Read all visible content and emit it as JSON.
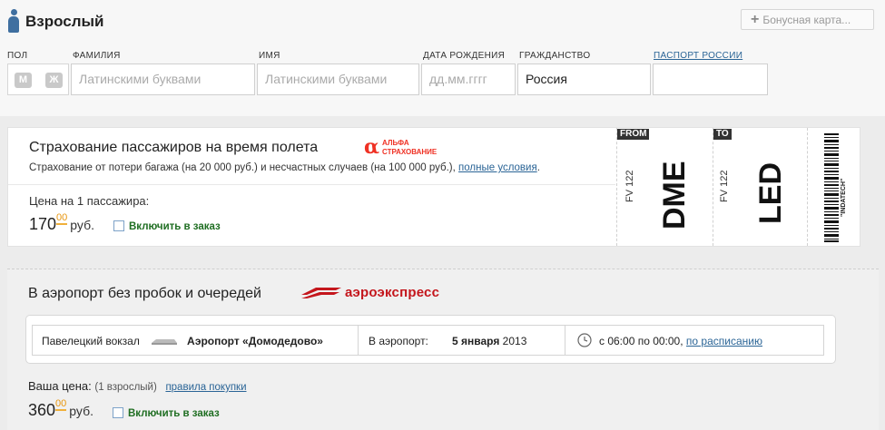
{
  "passenger": {
    "title": "Взрослый",
    "bonus_card_label": "Бонусная карта...",
    "fields": {
      "gender_label": "ПОЛ",
      "gender_male": "М",
      "gender_female": "Ж",
      "surname_label": "ФАМИЛИЯ",
      "surname_placeholder": "Латинскими буквами",
      "name_label": "ИМЯ",
      "name_placeholder": "Латинскими буквами",
      "birthdate_label": "ДАТА РОЖДЕНИЯ",
      "birthdate_placeholder": "дд.мм.гггг",
      "citizenship_label": "ГРАЖДАНСТВО",
      "citizenship_value": "Россия",
      "passport_label": "ПАСПОРТ РОССИИ",
      "passport_value": ""
    }
  },
  "insurance": {
    "title": "Страхование пассажиров на время полета",
    "provider_line1": "АЛЬФА",
    "provider_line2": "СТРАХОВАНИЕ",
    "description": "Страхование от потери багажа (на  20 000 руб.) и несчастных случаев (на 100 000 руб.),",
    "conditions_link": "полные условия",
    "price_label": "Цена на 1 пассажира:",
    "price_main": "170",
    "price_cents": "00",
    "currency": "руб.",
    "include_label": "Включить в заказ"
  },
  "ticket": {
    "from_tag": "FROM",
    "to_tag": "TO",
    "flight_no_from": "FV 122",
    "flight_no_to": "FV 122",
    "from_code": "DME",
    "to_code": "LED",
    "barcode_text": "\"INDATECH\""
  },
  "aeroexpress": {
    "title": "В аэропорт без пробок и очередей",
    "brand": "аэроэкспресс",
    "route_from": "Павелецкий вокзал",
    "route_to": "Аэропорт «Домодедово»",
    "direction_label": "В аэропорт:",
    "date_bold": "5 января",
    "date_year": "2013",
    "schedule_text": "с 06:00 по 00:00,",
    "schedule_link": "по расписанию",
    "your_price_label": "Ваша цена:",
    "passenger_count": "(1 взрослый)",
    "rules_link": "правила покупки",
    "price_main": "360",
    "price_cents": "00",
    "currency": "руб.",
    "include_label": "Включить в заказ"
  },
  "colors": {
    "accent_link": "#2a6496",
    "include_green": "#1f6e22",
    "alfa_red": "#ef3124",
    "aero_red": "#c4161c",
    "cents_orange": "#e8960e"
  }
}
